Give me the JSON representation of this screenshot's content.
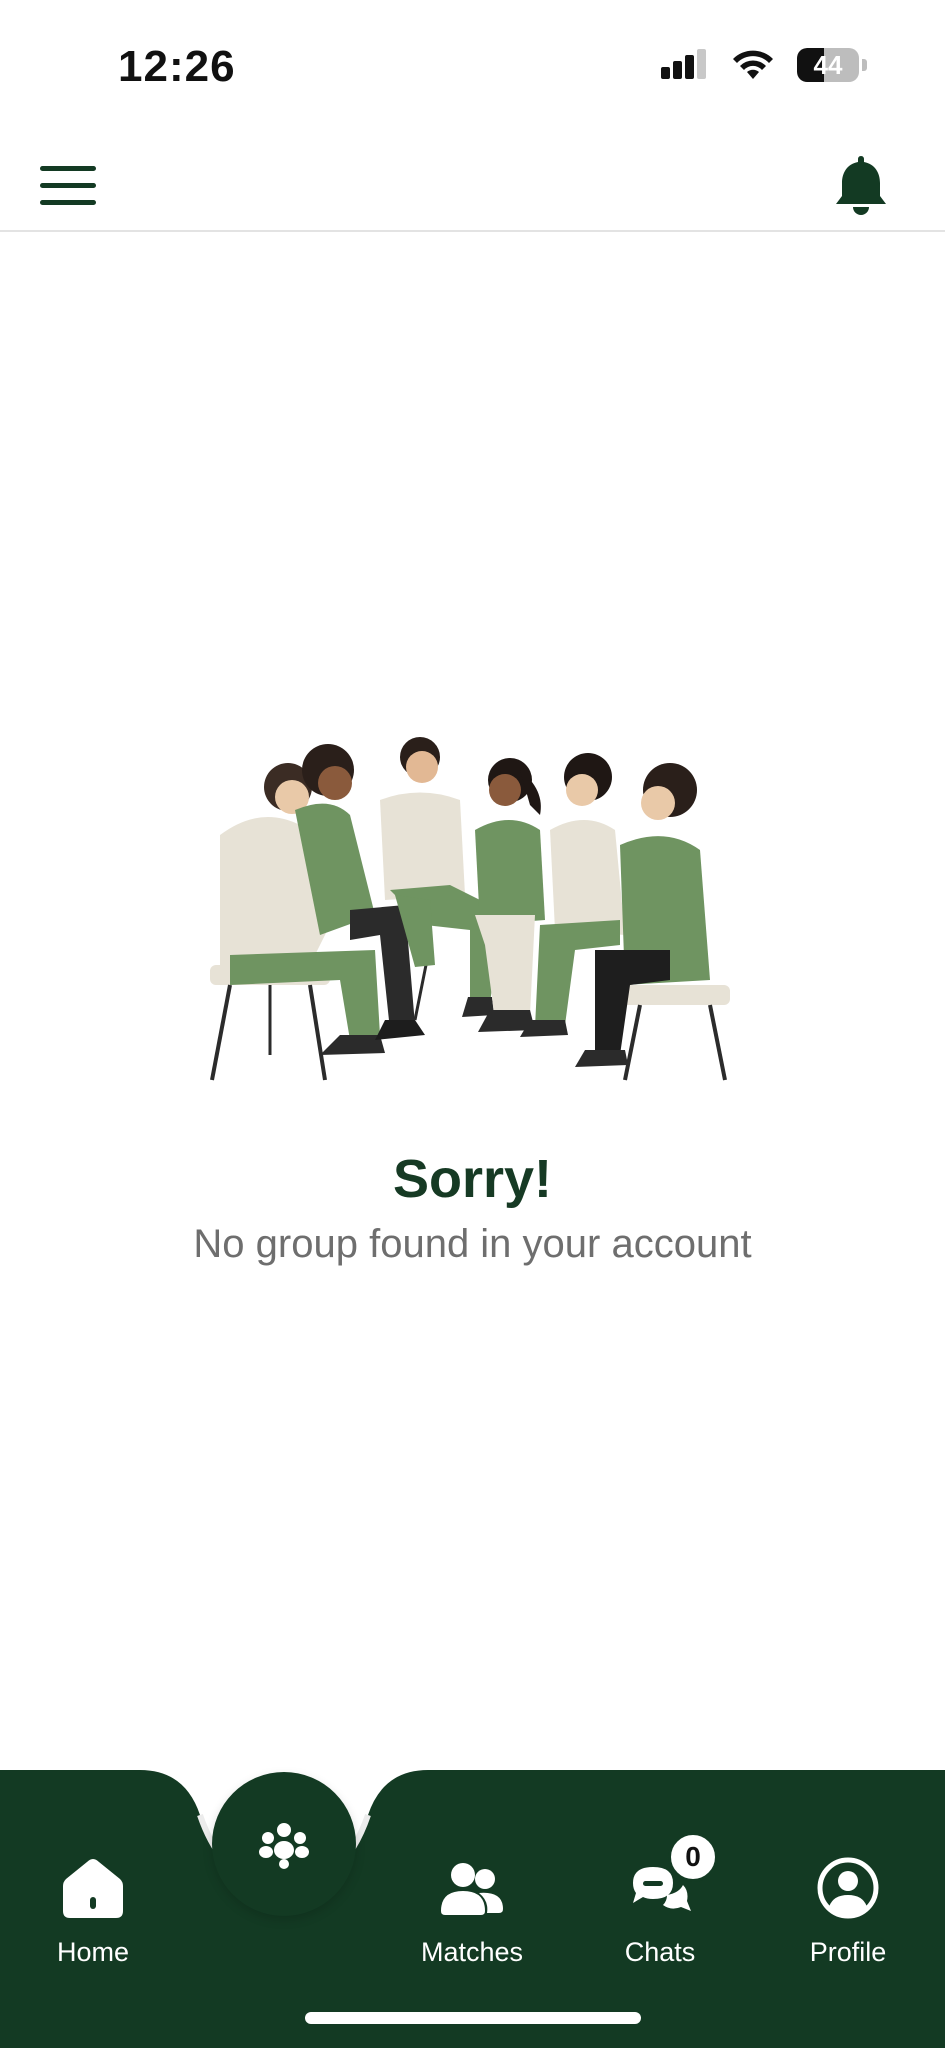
{
  "status_bar": {
    "time": "12:26",
    "battery": "44",
    "battery_level": 0.44
  },
  "header": {
    "menu_icon": "hamburger-menu-icon",
    "notification_icon": "bell-icon"
  },
  "empty_state": {
    "illustration": "group-of-people-illustration",
    "title": "Sorry!",
    "subtitle": "No group found in your account"
  },
  "bottom_nav": {
    "items": [
      {
        "label": "Home",
        "icon": "home-icon"
      },
      {
        "label": "Matches",
        "icon": "users-icon"
      },
      {
        "label": "Chats",
        "icon": "chat-bubbles-icon",
        "badge": "0"
      },
      {
        "label": "Profile",
        "icon": "user-circle-icon"
      }
    ],
    "center_button_icon": "group-icon"
  },
  "colors": {
    "primary": "#133a23",
    "title": "#163a24",
    "subtitle": "#6e6e6e",
    "illustration_green": "#6f9461",
    "illustration_cream": "#e7e2d6"
  }
}
